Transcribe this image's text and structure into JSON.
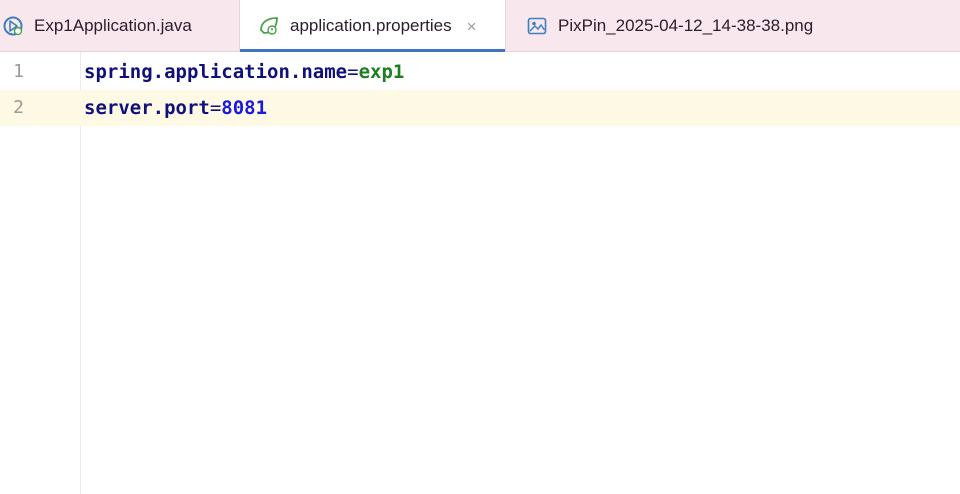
{
  "tabs": [
    {
      "label": "Exp1Application.java",
      "icon": "spring-run-icon",
      "active": false
    },
    {
      "label": "application.properties",
      "icon": "spring-leaf-icon",
      "active": true,
      "close": "×"
    },
    {
      "label": "PixPin_2025-04-12_14-38-38.png",
      "icon": "image-icon",
      "active": false
    }
  ],
  "editor": {
    "lines": [
      {
        "number": "1",
        "key": "spring.application.name",
        "eq": "=",
        "value": "exp1"
      },
      {
        "number": "2",
        "key": "server.port",
        "eq": "=",
        "value": "8081"
      }
    ]
  },
  "colors": {
    "tabbar_bg": "#f8e8ee",
    "active_tab_bar": "#3d74c2",
    "key": "#10107c",
    "string_value": "#1f7f1f",
    "number_value": "#1a1adf",
    "current_line": "#fdf9e4"
  }
}
